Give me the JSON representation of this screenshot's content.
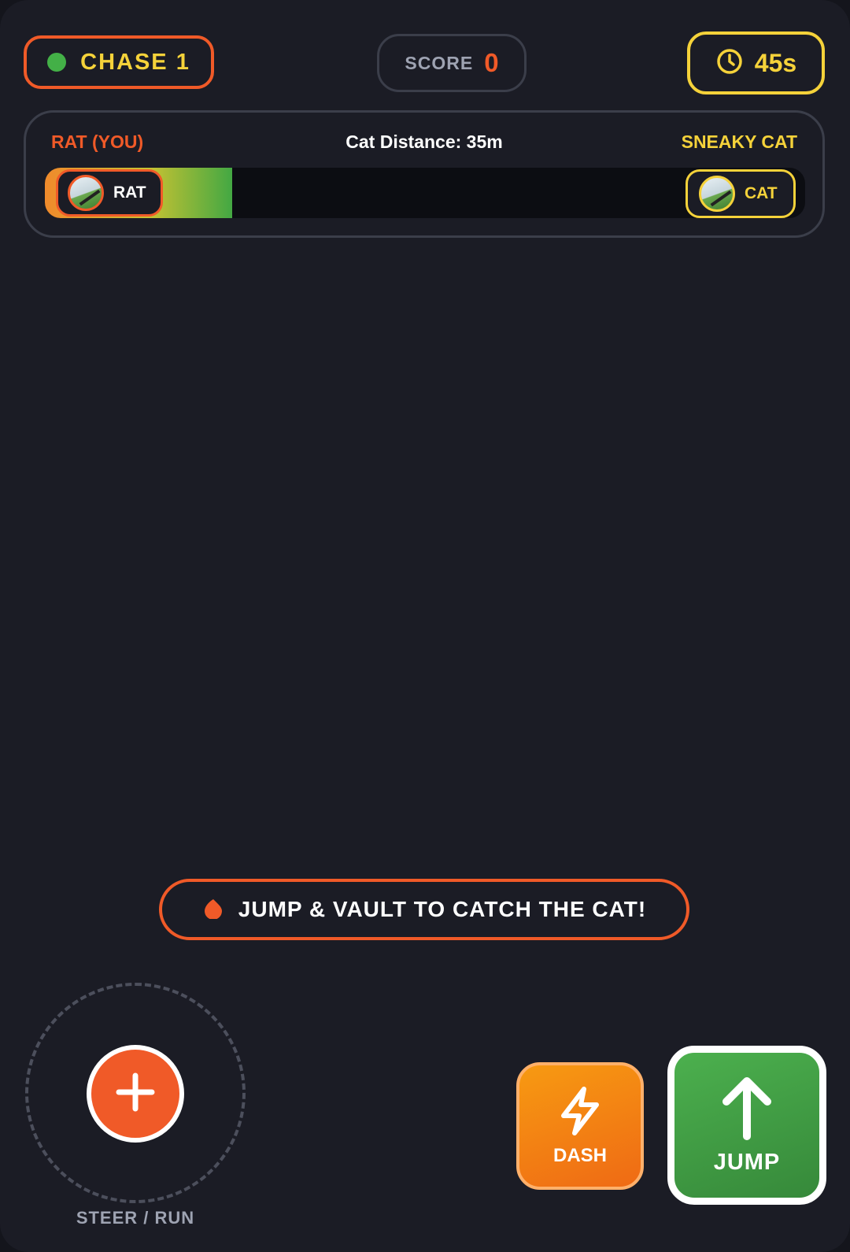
{
  "hud": {
    "chase_label": "CHASE 1",
    "score_label": "SCORE",
    "score_value": "0",
    "timer_value": "45s"
  },
  "progress": {
    "left_label": "RAT (YOU)",
    "center_label": "Cat Distance: 35m",
    "right_label": "SNEAKY CAT",
    "rat_chip_label": "RAT",
    "cat_chip_label": "CAT",
    "fill_fraction": 0.246
  },
  "hint": {
    "text": "JUMP & VAULT TO CATCH THE CAT!"
  },
  "controls": {
    "joystick_label": "STEER / RUN",
    "dash_label": "DASH",
    "jump_label": "JUMP"
  },
  "icons": {
    "status": "status-dot-icon",
    "timer": "clock-icon",
    "hint": "flame-icon",
    "joystick": "plus-icon",
    "dash": "lightning-icon",
    "jump": "arrow-up-icon"
  },
  "colors": {
    "accent_orange": "#f05a28",
    "accent_yellow": "#f5d23a",
    "status_green": "#43b047",
    "background": "#1b1c25"
  }
}
